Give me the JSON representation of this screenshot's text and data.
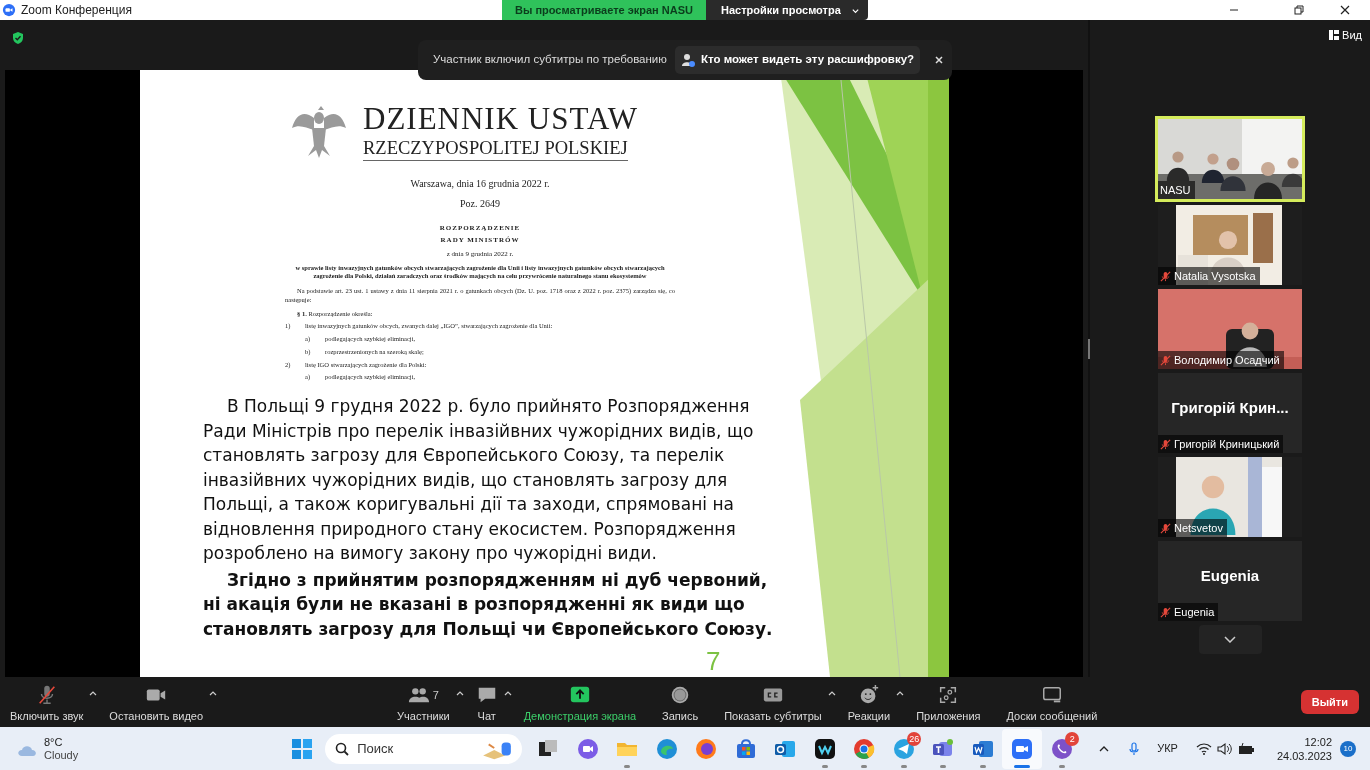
{
  "window": {
    "title": "Zoom Конференция"
  },
  "share_banner": {
    "text": "Вы просматриваете экран NASU",
    "settings_label": "Настройки просмотра"
  },
  "caption_notice": {
    "text": "Участник включил субтитры по требованию",
    "link": "Кто может видеть эту расшифровку?"
  },
  "view_button": {
    "label": "Вид"
  },
  "slide": {
    "header_title": "DZIENNIK USTAW",
    "header_subtitle": "RZECZYPOSPOLITEJ POLSKIEJ",
    "date": "Warszawa, dnia 16 grudnia 2022 r.",
    "position": "Poz. 2649",
    "decree_title": "ROZPORZĄDZENIE",
    "decree_subtitle": "RADY MINISTRÓW",
    "decree_date": "z dnia 9 grudnia 2022 r.",
    "decree_subject": "w sprawie listy inwazyjnych gatunków obcych stwarzających zagrożenie dla Unii i listy inwazyjnych gatunków obcych stwarzających zagrożenie dla Polski, działań zaradczych oraz środków mających na celu przywrócenie naturalnego stanu ekosystemów",
    "preamble": "Na podstawie art. 23 ust. 1 ustawy z dnia 11 sierpnia 2021 r. o gatunkach obcych (Dz. U. poz. 1718 oraz z 2022 r. poz. 2375) zarządza się, co następuje:",
    "section": "**§ 1.** Rozporządzenie określa:",
    "items": [
      {
        "marker": "1)",
        "text": "listę inwazyjnych gatunków obcych, zwanych dalej „IGO”, stwarzających zagrożenie dla Unii:",
        "children": [
          {
            "marker": "a)",
            "text": "podlegających szybkiej eliminacji,"
          },
          {
            "marker": "b)",
            "text": "rozprzestrzenionych na szeroką skalę;"
          }
        ]
      },
      {
        "marker": "2)",
        "text": "listę IGO stwarzających zagrożenie dla Polski:",
        "children": [
          {
            "marker": "a)",
            "text": "podlegających szybkiej eliminacji,"
          }
        ]
      }
    ],
    "paragraph": "В Польщі 9 грудня 2022 р. було прийнято Розпорядження Ради Міністрів про перелік інвазійвних чужорідних видів, що становлять загрозу для Європейського Союзу, та перелік інвазійвних чужорідних видів, що становлять загрозу для Польщі, а також коригувальні дії та заходи, спрямовані на відновлення природного стану екосистем. Розпорядження розроблено на вимогу закону про чужорідні види.",
    "bold_paragraph": "Згідно з прийнятим розпорядженням ні дуб червоний, ні акація були не вказані в розпорядженні як види що становлять загрозу для Польщі чи Європейського Союзу.",
    "page_number": "7"
  },
  "participants": [
    {
      "name": "NASU",
      "kind": "video",
      "muted": false,
      "active": true
    },
    {
      "name": "Natalia Vysotska",
      "kind": "video",
      "muted": true,
      "active": false
    },
    {
      "name": "Володимир Осадчий",
      "kind": "video",
      "muted": true,
      "active": false
    },
    {
      "name": "Григорій Криницький",
      "kind": "name",
      "display_name": "Григорій Крин...",
      "muted": true,
      "active": false
    },
    {
      "name": "Netsvetov",
      "kind": "video",
      "muted": true,
      "active": false
    },
    {
      "name": "Eugenia",
      "kind": "name",
      "display_name": "Eugenia",
      "muted": true,
      "active": false
    }
  ],
  "toolbar": {
    "left": [
      {
        "label": "Включить звук",
        "kind": "mic",
        "muted": true,
        "caret": true,
        "active": false
      },
      {
        "label": "Остановить видео",
        "kind": "video",
        "caret": true,
        "active": false
      }
    ],
    "center": [
      {
        "label": "Участники",
        "kind": "participants",
        "count": "7",
        "caret": true,
        "active": false
      },
      {
        "label": "Чат",
        "kind": "chat",
        "caret": true,
        "active": false
      },
      {
        "label": "Демонстрация экрана",
        "kind": "share",
        "caret": false,
        "active": true
      },
      {
        "label": "Запись",
        "kind": "record",
        "caret": false,
        "active": false
      },
      {
        "label": "Показать субтитры",
        "kind": "captions",
        "caret": true,
        "active": false
      },
      {
        "label": "Реакции",
        "kind": "reactions",
        "caret": true,
        "active": false
      },
      {
        "label": "Приложения",
        "kind": "apps",
        "caret": false,
        "active": false
      },
      {
        "label": "Доски сообщений",
        "kind": "whiteboards",
        "caret": false,
        "active": false
      }
    ],
    "leave_button": "Выйти"
  },
  "taskbar": {
    "weather": {
      "temperature": "8°C",
      "condition": "Cloudy"
    },
    "search_placeholder": "Поиск",
    "apps": [
      {
        "kind": "taskview",
        "running": false,
        "active": false
      },
      {
        "kind": "meet",
        "running": false,
        "active": false
      },
      {
        "kind": "explorer",
        "running": true,
        "active": false
      },
      {
        "kind": "edge",
        "running": false,
        "active": false
      },
      {
        "kind": "firefox",
        "running": false,
        "active": false
      },
      {
        "kind": "store",
        "running": false,
        "active": false
      },
      {
        "kind": "outlook",
        "running": false,
        "active": false
      },
      {
        "kind": "webex",
        "running": true,
        "active": false
      },
      {
        "kind": "chrome",
        "running": true,
        "active": false
      },
      {
        "kind": "telegram",
        "running": true,
        "active": false,
        "badge": "26"
      },
      {
        "kind": "teams",
        "running": true,
        "active": false
      },
      {
        "kind": "word",
        "running": true,
        "active": false
      },
      {
        "kind": "zoom",
        "running": true,
        "active": true
      },
      {
        "kind": "viber",
        "running": true,
        "active": false,
        "badge": "2"
      }
    ],
    "language": "УКР",
    "time": "12:02",
    "date": "24.03.2023",
    "notifications": "10"
  }
}
